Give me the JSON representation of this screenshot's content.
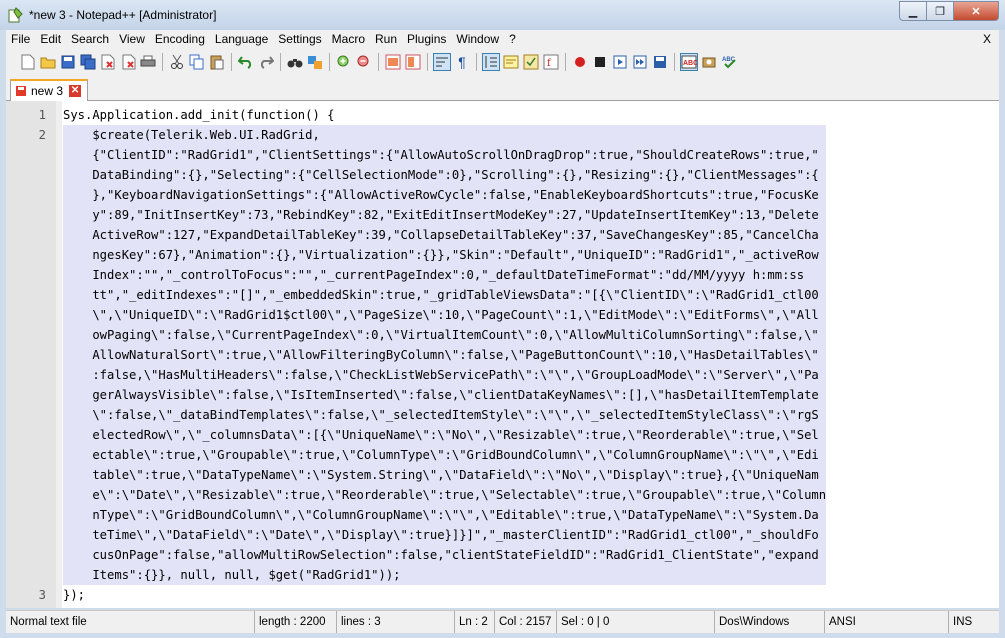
{
  "window": {
    "title": "*new  3 - Notepad++ [Administrator]"
  },
  "menu": [
    "File",
    "Edit",
    "Search",
    "View",
    "Encoding",
    "Language",
    "Settings",
    "Macro",
    "Run",
    "Plugins",
    "Window",
    "?"
  ],
  "menu_close": "X",
  "toolbar": {
    "icons": [
      "new-file-icon",
      "open-folder-icon",
      "save-icon",
      "save-all-icon",
      "close-icon",
      "close-all-icon",
      "print-icon",
      "cut-icon",
      "copy-icon",
      "paste-icon",
      "undo-icon",
      "redo-icon",
      "find-icon",
      "replace-icon",
      "zoom-in-icon",
      "zoom-out-icon",
      "sync-v-icon",
      "sync-h-icon",
      "word-wrap-icon",
      "show-all-chars-icon",
      "indent-guide-icon",
      "udl-icon",
      "doc-map-icon",
      "function-list-icon",
      "record-macro-icon",
      "stop-macro-icon",
      "play-macro-icon",
      "run-macro-multiple-icon",
      "save-macro-icon",
      "spell-check-icon",
      "spell-settings-icon",
      "abc-check-icon"
    ]
  },
  "tab": {
    "label": "new  3"
  },
  "editor": {
    "line_numbers": [
      "1",
      "2",
      "",
      "",
      "",
      "",
      "",
      "",
      "",
      "",
      "",
      "",
      "",
      "",
      "",
      "",
      "",
      "",
      "",
      "",
      "",
      "",
      "",
      "",
      "3"
    ],
    "lines": [
      "Sys.Application.add_init(function() {",
      "    $create(Telerik.Web.UI.RadGrid,",
      "    {\"ClientID\":\"RadGrid1\",\"ClientSettings\":{\"AllowAutoScrollOnDragDrop\":true,\"ShouldCreateRows\":true,\"",
      "    DataBinding\":{},\"Selecting\":{\"CellSelectionMode\":0},\"Scrolling\":{},\"Resizing\":{},\"ClientMessages\":{",
      "    },\"KeyboardNavigationSettings\":{\"AllowActiveRowCycle\":false,\"EnableKeyboardShortcuts\":true,\"FocusKe",
      "    y\":89,\"InitInsertKey\":73,\"RebindKey\":82,\"ExitEditInsertModeKey\":27,\"UpdateInsertItemKey\":13,\"Delete",
      "    ActiveRow\":127,\"ExpandDetailTableKey\":39,\"CollapseDetailTableKey\":37,\"SaveChangesKey\":85,\"CancelCha",
      "    ngesKey\":67},\"Animation\":{},\"Virtualization\":{}},\"Skin\":\"Default\",\"UniqueID\":\"RadGrid1\",\"_activeRow",
      "    Index\":\"\",\"_controlToFocus\":\"\",\"_currentPageIndex\":0,\"_defaultDateTimeFormat\":\"dd/MM/yyyy h:mm:ss",
      "    tt\",\"_editIndexes\":\"[]\",\"_embeddedSkin\":true,\"_gridTableViewsData\":\"[{\\\"ClientID\\\":\\\"RadGrid1_ctl00",
      "    \\\",\\\"UniqueID\\\":\\\"RadGrid1$ctl00\\\",\\\"PageSize\\\":10,\\\"PageCount\\\":1,\\\"EditMode\\\":\\\"EditForms\\\",\\\"All",
      "    owPaging\\\":false,\\\"CurrentPageIndex\\\":0,\\\"VirtualItemCount\\\":0,\\\"AllowMultiColumnSorting\\\":false,\\\"",
      "    AllowNaturalSort\\\":true,\\\"AllowFilteringByColumn\\\":false,\\\"PageButtonCount\\\":10,\\\"HasDetailTables\\\"",
      "    :false,\\\"HasMultiHeaders\\\":false,\\\"CheckListWebServicePath\\\":\\\"\\\",\\\"GroupLoadMode\\\":\\\"Server\\\",\\\"Pa",
      "    gerAlwaysVisible\\\":false,\\\"IsItemInserted\\\":false,\\\"clientDataKeyNames\\\":[],\\\"hasDetailItemTemplate",
      "    \\\":false,\\\"_dataBindTemplates\\\":false,\\\"_selectedItemStyle\\\":\\\"\\\",\\\"_selectedItemStyleClass\\\":\\\"rgS",
      "    electedRow\\\",\\\"_columnsData\\\":[{\\\"UniqueName\\\":\\\"No\\\",\\\"Resizable\\\":true,\\\"Reorderable\\\":true,\\\"Sel",
      "    ectable\\\":true,\\\"Groupable\\\":true,\\\"ColumnType\\\":\\\"GridBoundColumn\\\",\\\"ColumnGroupName\\\":\\\"\\\",\\\"Edi",
      "    table\\\":true,\\\"DataTypeName\\\":\\\"System.String\\\",\\\"DataField\\\":\\\"No\\\",\\\"Display\\\":true},{\\\"UniqueNam",
      "    e\\\":\\\"Date\\\",\\\"Resizable\\\":true,\\\"Reorderable\\\":true,\\\"Selectable\\\":true,\\\"Groupable\\\":true,\\\"Column",
      "    nType\\\":\\\"GridBoundColumn\\\",\\\"ColumnGroupName\\\":\\\"\\\",\\\"Editable\\\":true,\\\"DataTypeName\\\":\\\"System.Da",
      "    teTime\\\",\\\"DataField\\\":\\\"Date\\\",\\\"Display\\\":true}]}]\",\"_masterClientID\":\"RadGrid1_ctl00\",\"_shouldFo",
      "    cusOnPage\":false,\"allowMultiRowSelection\":false,\"clientStateFieldID\":\"RadGrid1_ClientState\",\"expand",
      "    Items\":{}}, null, null, $get(\"RadGrid1\"));",
      "});"
    ]
  },
  "status": {
    "file_type": "Normal text file",
    "length": "length : 2200",
    "lines": "lines : 3",
    "ln": "Ln : 2",
    "col": "Col : 2157",
    "sel": "Sel : 0 | 0",
    "eol": "Dos\\Windows",
    "encoding": "ANSI",
    "mode": "INS"
  },
  "colors": {
    "selection": "#e3e3f7",
    "gutter": "#e4e4e4",
    "titlebar": "#c3d4e8"
  }
}
